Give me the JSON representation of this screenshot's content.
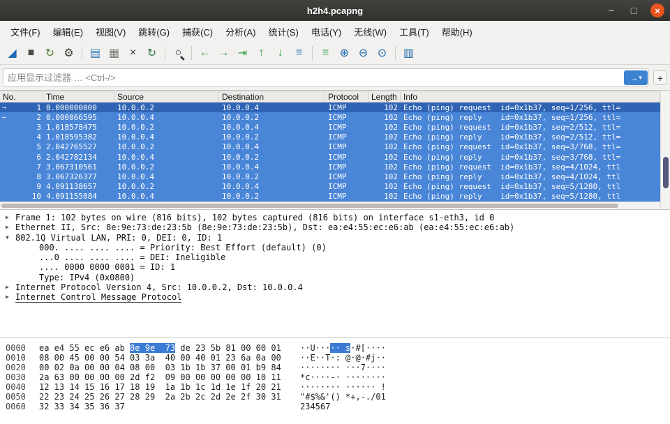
{
  "window": {
    "title": "h2h4.pcapng",
    "controls": {
      "minimize": "−",
      "maximize": "□",
      "close": "×"
    }
  },
  "menu": {
    "items": [
      {
        "name": "file",
        "label": "文件(F)"
      },
      {
        "name": "edit",
        "label": "编辑(E)"
      },
      {
        "name": "view",
        "label": "视图(V)"
      },
      {
        "name": "go",
        "label": "跳转(G)"
      },
      {
        "name": "capture",
        "label": "捕获(C)"
      },
      {
        "name": "analyze",
        "label": "分析(A)"
      },
      {
        "name": "statistics",
        "label": "统计(S)"
      },
      {
        "name": "telephony",
        "label": "电话(Y)"
      },
      {
        "name": "wireless",
        "label": "无线(W)"
      },
      {
        "name": "tools",
        "label": "工具(T)"
      },
      {
        "name": "help",
        "label": "帮助(H)"
      }
    ]
  },
  "toolbar": {
    "buttons": [
      {
        "name": "start-capture",
        "glyph": "◢",
        "color": "#1d6ab2"
      },
      {
        "name": "stop-capture",
        "glyph": "■",
        "color": "#4d4b48"
      },
      {
        "name": "restart-capture",
        "glyph": "↻",
        "color": "#55803c"
      },
      {
        "name": "capture-options",
        "glyph": "⚙",
        "color": "#3d3b38",
        "sep_after": true
      },
      {
        "name": "open-file",
        "glyph": "▤",
        "color": "#2e79b8"
      },
      {
        "name": "save-file",
        "glyph": "▦",
        "color": "#7a7873"
      },
      {
        "name": "close-file",
        "glyph": "×",
        "color": "#3d3b38"
      },
      {
        "name": "reload-file",
        "glyph": "↻",
        "color": "#2c7d4f",
        "sep_after": true
      },
      {
        "name": "find-packet",
        "glyph": "○",
        "color": "#3d3b38",
        "mag": true,
        "sep_after": true
      },
      {
        "name": "go-back",
        "glyph": "←",
        "color": "#2f9e44"
      },
      {
        "name": "go-forward",
        "glyph": "→",
        "color": "#2f9e44"
      },
      {
        "name": "go-to-packet",
        "glyph": "⇥",
        "color": "#2f9e44"
      },
      {
        "name": "go-first",
        "glyph": "↑",
        "color": "#2f9e44"
      },
      {
        "name": "go-last",
        "glyph": "↓",
        "color": "#2f9e44"
      },
      {
        "name": "auto-scroll",
        "glyph": "≡",
        "color": "#2e79b8",
        "sep_after": true
      },
      {
        "name": "colorize",
        "glyph": "≡",
        "color": "#3f9e4f"
      },
      {
        "name": "zoom-in",
        "glyph": "⊕",
        "color": "#1d6ab2"
      },
      {
        "name": "zoom-out",
        "glyph": "⊖",
        "color": "#1d6ab2"
      },
      {
        "name": "zoom-original",
        "glyph": "⊙",
        "color": "#1d6ab2",
        "sep_after": true
      },
      {
        "name": "resize-columns",
        "glyph": "▥",
        "color": "#1d6ab2"
      }
    ]
  },
  "filter": {
    "placeholder": "应用显示过滤器 … <Ctrl-/>",
    "apply_glyph": "→",
    "dropdown_glyph": "▾",
    "add_label": "+"
  },
  "packet_list": {
    "columns": [
      {
        "key": "no",
        "label": "No."
      },
      {
        "key": "time",
        "label": "Time"
      },
      {
        "key": "source",
        "label": "Source"
      },
      {
        "key": "destination",
        "label": "Destination"
      },
      {
        "key": "protocol",
        "label": "Protocol"
      },
      {
        "key": "length",
        "label": "Length"
      },
      {
        "key": "info",
        "label": "Info"
      }
    ],
    "rows": [
      {
        "no": "1",
        "marker": "→",
        "focused": true,
        "time": "0.000000000",
        "source": "10.0.0.2",
        "destination": "10.0.0.4",
        "protocol": "ICMP",
        "length": "102",
        "info": "Echo (ping) request  id=0x1b37, seq=1/256, ttl="
      },
      {
        "no": "2",
        "marker": "←",
        "time": "0.000066595",
        "source": "10.0.0.4",
        "destination": "10.0.0.2",
        "protocol": "ICMP",
        "length": "102",
        "info": "Echo (ping) reply    id=0x1b37, seq=1/256, ttl="
      },
      {
        "no": "3",
        "time": "1.018578475",
        "source": "10.0.0.2",
        "destination": "10.0.0.4",
        "protocol": "ICMP",
        "length": "102",
        "info": "Echo (ping) request  id=0x1b37, seq=2/512, ttl="
      },
      {
        "no": "4",
        "time": "1.018595382",
        "source": "10.0.0.4",
        "destination": "10.0.0.2",
        "protocol": "ICMP",
        "length": "102",
        "info": "Echo (ping) reply    id=0x1b37, seq=2/512, ttl="
      },
      {
        "no": "5",
        "time": "2.042765527",
        "source": "10.0.0.2",
        "destination": "10.0.0.4",
        "protocol": "ICMP",
        "length": "102",
        "info": "Echo (ping) request  id=0x1b37, seq=3/768, ttl="
      },
      {
        "no": "6",
        "time": "2.042782134",
        "source": "10.0.0.4",
        "destination": "10.0.0.2",
        "protocol": "ICMP",
        "length": "102",
        "info": "Echo (ping) reply    id=0x1b37, seq=3/768, ttl="
      },
      {
        "no": "7",
        "time": "3.067310561",
        "source": "10.0.0.2",
        "destination": "10.0.0.4",
        "protocol": "ICMP",
        "length": "102",
        "info": "Echo (ping) request  id=0x1b37, seq=4/1024, ttl"
      },
      {
        "no": "8",
        "time": "3.067326377",
        "source": "10.0.0.4",
        "destination": "10.0.0.2",
        "protocol": "ICMP",
        "length": "102",
        "info": "Echo (ping) reply    id=0x1b37, seq=4/1024, ttl"
      },
      {
        "no": "9",
        "time": "4.091138657",
        "source": "10.0.0.2",
        "destination": "10.0.0.4",
        "protocol": "ICMP",
        "length": "102",
        "info": "Echo (ping) request  id=0x1b37, seq=5/1280, ttl"
      },
      {
        "no": "10",
        "time": "4.091155084",
        "source": "10.0.0.4",
        "destination": "10.0.0.2",
        "protocol": "ICMP",
        "length": "102",
        "info": "Echo (ping) reply    id=0x1b37, seq=5/1280, ttl"
      }
    ]
  },
  "details": {
    "lines": [
      {
        "exp": "▶",
        "indent": 0,
        "text": "Frame 1: 102 bytes on wire (816 bits), 102 bytes captured (816 bits) on interface s1-eth3, id 0"
      },
      {
        "exp": "▶",
        "indent": 0,
        "text": "Ethernet II, Src: 8e:9e:73:de:23:5b (8e:9e:73:de:23:5b), Dst: ea:e4:55:ec:e6:ab (ea:e4:55:ec:e6:ab)"
      },
      {
        "exp": "▼",
        "indent": 0,
        "text": "802.1Q Virtual LAN, PRI: 0, DEI: 0, ID: 1"
      },
      {
        "exp": "",
        "indent": 1,
        "text": "000. .... .... .... = Priority: Best Effort (default) (0)"
      },
      {
        "exp": "",
        "indent": 1,
        "text": "...0 .... .... .... = DEI: Ineligible"
      },
      {
        "exp": "",
        "indent": 1,
        "text": ".... 0000 0000 0001 = ID: 1"
      },
      {
        "exp": "",
        "indent": 1,
        "text": "Type: IPv4 (0x0800)"
      },
      {
        "exp": "▶",
        "indent": 0,
        "text": "Internet Protocol Version 4, Src: 10.0.0.2, Dst: 10.0.0.4"
      },
      {
        "exp": "▶",
        "indent": 0,
        "text": "Internet Control Message Protocol",
        "underline": true
      }
    ]
  },
  "hex_dump": {
    "rows": [
      {
        "offset": "0000",
        "hex": [
          {
            "t": "ea e4 55 ec e6 ab ",
            "h": false
          },
          {
            "t": "8e 9e  73",
            "h": true
          },
          {
            "t": " de 23 5b 81 00 00 01",
            "h": false
          }
        ],
        "ascii": [
          {
            "t": "··U···",
            "h": false
          },
          {
            "t": "·· s",
            "h": true
          },
          {
            "t": "·#[····",
            "h": false
          }
        ]
      },
      {
        "offset": "0010",
        "hex": [
          {
            "t": "08 00 45 00 00 54 03 3a  40 00 40 01 23 6a 0a 00",
            "h": false
          }
        ],
        "ascii": [
          {
            "t": "··E··T·: @·@·#j··",
            "h": false
          }
        ]
      },
      {
        "offset": "0020",
        "hex": [
          {
            "t": "00 02 0a 00 00 04 08 00  03 1b 1b 37 00 01 b9 84",
            "h": false
          }
        ],
        "ascii": [
          {
            "t": "········ ···7····",
            "h": false
          }
        ]
      },
      {
        "offset": "0030",
        "hex": [
          {
            "t": "2a 63 00 00 00 00 2d f2  09 00 00 00 00 00 10 11",
            "h": false
          }
        ],
        "ascii": [
          {
            "t": "*c····-· ········",
            "h": false
          }
        ]
      },
      {
        "offset": "0040",
        "hex": [
          {
            "t": "12 13 14 15 16 17 18 19  1a 1b 1c 1d 1e 1f 20 21",
            "h": false
          }
        ],
        "ascii": [
          {
            "t": "········ ······ !",
            "h": false
          }
        ]
      },
      {
        "offset": "0050",
        "hex": [
          {
            "t": "22 23 24 25 26 27 28 29  2a 2b 2c 2d 2e 2f 30 31",
            "h": false
          }
        ],
        "ascii": [
          {
            "t": "\"#$%&'() *+,-./01",
            "h": false
          }
        ]
      },
      {
        "offset": "0060",
        "hex": [
          {
            "t": "32 33 34 35 36 37",
            "h": false
          }
        ],
        "ascii": [
          {
            "t": "234567",
            "h": false
          }
        ]
      }
    ]
  },
  "colors": {
    "selection_blue": "#4a86d8",
    "focused_blue": "#2f64b5",
    "hex_highlight": "#3b7bd4",
    "close_orange": "#e9541f"
  }
}
